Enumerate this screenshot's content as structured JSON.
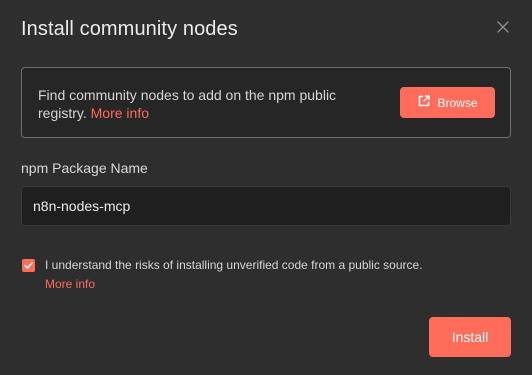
{
  "dialog": {
    "title": "Install community nodes",
    "close_icon": "close-icon"
  },
  "info": {
    "text": "Find community nodes to add on the npm public registry.",
    "link": "More info",
    "browse_label": "Browse",
    "browse_icon": "external-link-icon"
  },
  "package": {
    "label": "npm Package Name",
    "value": "n8n-nodes-mcp"
  },
  "consent": {
    "checked": true,
    "text": "I understand the risks of installing unverified code from a public source.",
    "link": "More info"
  },
  "actions": {
    "install_label": "Install"
  },
  "colors": {
    "accent": "#ff6d5a",
    "background": "#2e2e2e"
  }
}
